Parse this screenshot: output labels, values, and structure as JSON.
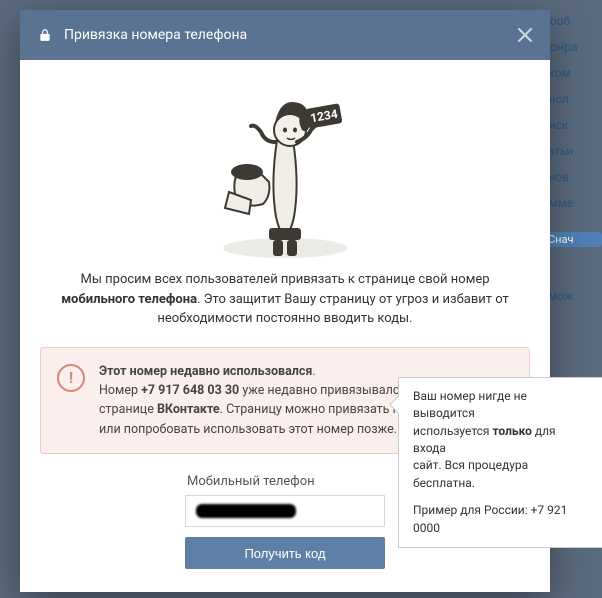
{
  "bg_menu": [
    "Сооб",
    "Понра",
    "еком",
    "ансл",
    "оиск",
    "татьи",
    "бнов",
    "омме"
  ],
  "bg_pill": "Снач",
  "bg_extra": "эмож",
  "modal": {
    "title": "Привязка номера телефона",
    "intro_pre": "Мы просим всех пользователей привязать к странице свой номер ",
    "intro_bold": "мобильного телефона",
    "intro_post": ". Это защитит Вашу страницу от угроз и избавит от необходимости постоянно вводить коды.",
    "warning": {
      "line1_bold": "Этот номер недавно использовался",
      "line1_post": ".",
      "l2_pre": "Номер ",
      "l2_phone": "+7 917 648 03 30",
      "l2_mid": " уже недавно привязывался к другой странице ",
      "l2_bold2": "ВКонтакте",
      "l2_post": ". Страницу можно привязать к другому номеру или попробовать использовать этот номер позже."
    },
    "field_label": "Мобильный телефон",
    "submit": "Получить код"
  },
  "tooltip": {
    "p1_pre": "Ваш номер нигде не выводится",
    "p1_mid": "используется ",
    "p1_bold": "только",
    "p1_post": " для входа",
    "p1_line3": "сайт. Вся процедура бесплатна.",
    "p2": "Пример для России: +7 921 0000"
  }
}
